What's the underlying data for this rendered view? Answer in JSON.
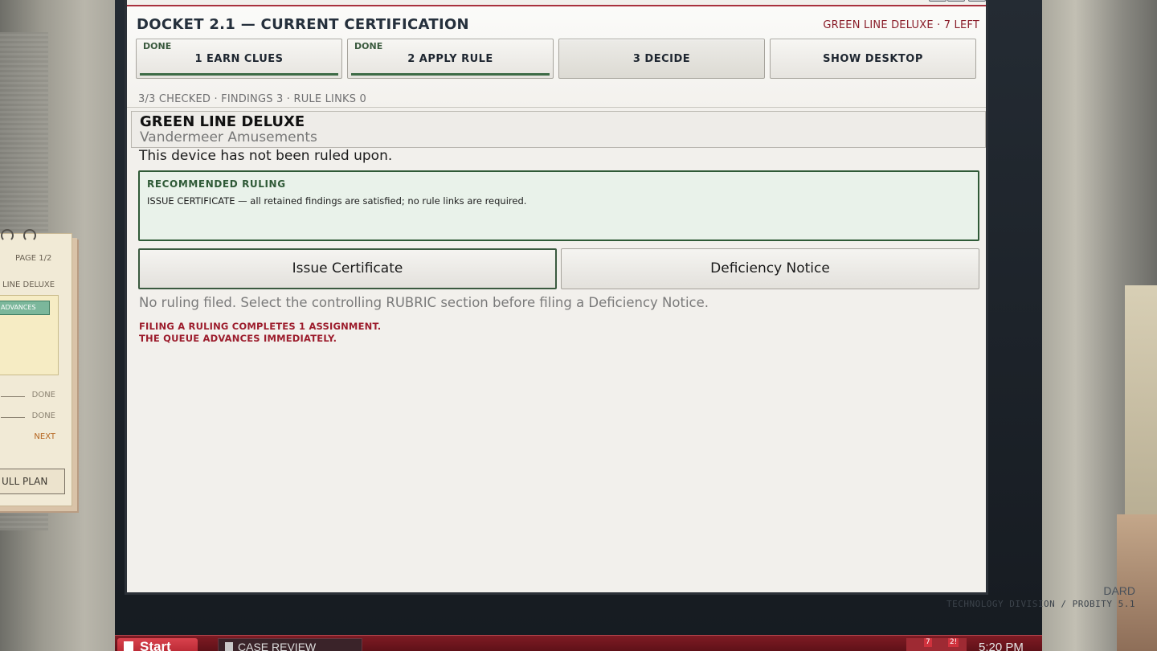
{
  "app": {
    "title": "DOCKET 2.1 — CURRENT CERTIFICATION",
    "queue_status": "GREEN LINE DELUXE · 7 LEFT"
  },
  "steps": [
    {
      "label": "1  EARN CLUES",
      "status": "DONE"
    },
    {
      "label": "2  APPLY RULE",
      "status": "DONE"
    },
    {
      "label": "3  DECIDE",
      "status": ""
    },
    {
      "label": "SHOW DESKTOP",
      "status": ""
    }
  ],
  "progress_line": "3/3 CHECKED · FINDINGS 3 · RULE LINKS 0",
  "device": {
    "name": "GREEN LINE DELUXE",
    "manufacturer": "Vandermeer Amusements",
    "ruling_status": "This device has not been ruled upon."
  },
  "recommendation": {
    "title": "RECOMMENDED RULING",
    "text": "ISSUE CERTIFICATE — all retained findings are satisfied; no rule links are required."
  },
  "actions": {
    "issue": "Issue Certificate",
    "deficiency": "Deficiency Notice"
  },
  "hint": "No ruling filed. Select the controlling RUBRIC section before filing a Deficiency Notice.",
  "warning": {
    "line1": "FILING A RULING COMPLETES 1 ASSIGNMENT.",
    "line2": "THE QUEUE ADVANCES IMMEDIATELY."
  },
  "notepad": {
    "page": "PAGE 1/2",
    "device": "LINE DELUXE",
    "tag": "ADVANCES",
    "steps": [
      "DONE",
      "DONE",
      "NEXT"
    ],
    "button": "ULL PLAN"
  },
  "monitor": {
    "brand": "DARD",
    "division": "TECHNOLOGY DIVISION  /  PROBITY 5.1"
  },
  "taskbar": {
    "start": "Start",
    "task": "CASE REVIEW",
    "badge1": "7",
    "badge2": "2!",
    "clock": "5:20 PM"
  },
  "colors": {
    "accent_red": "#9c1c2c",
    "accent_green": "#2f5a37",
    "title_navy": "#25303c"
  }
}
